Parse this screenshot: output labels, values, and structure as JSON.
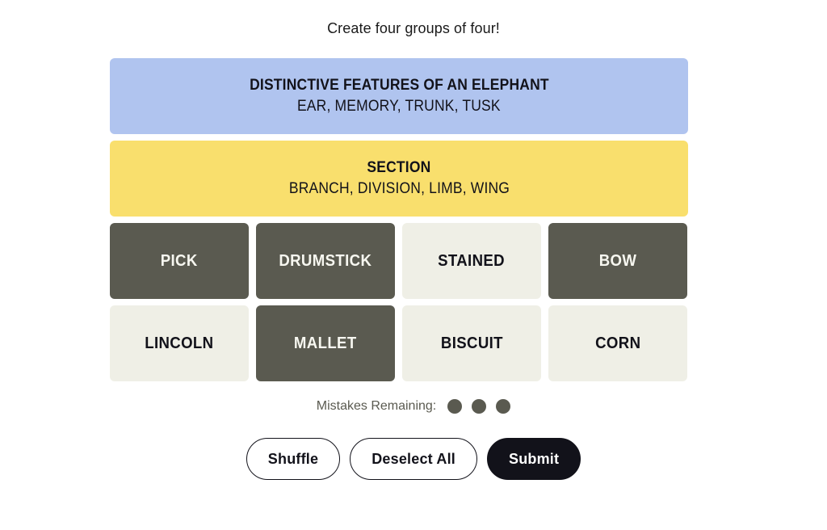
{
  "header": {
    "instruction": "Create four groups of four!"
  },
  "solved_groups": [
    {
      "title": "DISTINCTIVE FEATURES OF AN ELEPHANT",
      "members": "EAR, MEMORY, TRUNK, TUSK",
      "color": "#b0c4ef"
    },
    {
      "title": "SECTION",
      "members": "BRANCH, DIVISION, LIMB, WING",
      "color": "#f9df6d"
    }
  ],
  "tiles": [
    {
      "label": "PICK",
      "state": "selected"
    },
    {
      "label": "DRUMSTICK",
      "state": "selected"
    },
    {
      "label": "STAINED",
      "state": "unselected"
    },
    {
      "label": "BOW",
      "state": "selected"
    },
    {
      "label": "LINCOLN",
      "state": "unselected"
    },
    {
      "label": "MALLET",
      "state": "selected"
    },
    {
      "label": "BISCUIT",
      "state": "unselected"
    },
    {
      "label": "CORN",
      "state": "unselected"
    }
  ],
  "mistakes": {
    "label": "Mistakes Remaining:",
    "remaining": 3,
    "dot_color": "#5a5a50"
  },
  "actions": {
    "shuffle_label": "Shuffle",
    "deselect_label": "Deselect All",
    "submit_label": "Submit"
  },
  "colors": {
    "tile_selected": "#5a5a50",
    "tile_unselected": "#efefe6",
    "text_dark": "#12121a",
    "page_background": "#ffffff"
  }
}
